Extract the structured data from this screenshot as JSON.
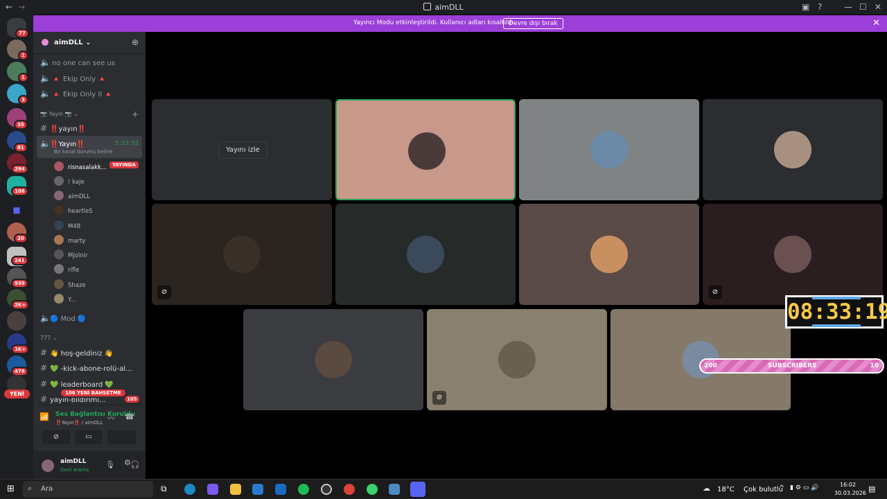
{
  "window": {
    "title": "aimDLL"
  },
  "banner": {
    "message": "Yayıncı Modu etkinleştirildi. Kullanıcı adları kısaltıldı.",
    "button": "Devre dışı bırak"
  },
  "guild_badges": [
    "77",
    "1",
    "1",
    "3",
    "35",
    "81",
    "294",
    "106",
    "20",
    "241",
    "939",
    "2K+",
    "1K+",
    "478"
  ],
  "guild_new": "YENİ",
  "server": {
    "name": "aimDLL"
  },
  "channels": {
    "c1": "no one can see us",
    "c2": "🔺 Ekip Only 🔺",
    "c3": "🔺 Ekip Only II 🔺",
    "cat_yayin": "Yayın",
    "c4": "‼️yayın‼️",
    "c5": "‼️Yayın‼️",
    "c5_timer": "5:13:53",
    "c5_status": "Bir kanal durumu belirle",
    "mod": "🔵 Mod 🔵",
    "cat_777": "777",
    "t1": "👋 hoş-geldiniz 👋",
    "t2": "💚 -kick-abone-rolü-al...",
    "t3": "💚 leaderboard 💚",
    "t4": "yayın-bildirimi...",
    "t4_count": "105",
    "mentions": "106 YENİ BAHSETME"
  },
  "voice_users": [
    "risnasalakk...",
    "! kaje",
    "aimDLL",
    "heartleS",
    "M48",
    "marty",
    "Mjolnir",
    "rifle",
    "Shaze",
    "Y..."
  ],
  "live_badge": "YAYINDA",
  "voice_status": {
    "title": "Ses Bağlantısı Kuruldu",
    "sub": "‼️Yayın‼️ / aimDLL"
  },
  "user": {
    "name": "aimDLL",
    "status": "Sesli arama"
  },
  "stage": {
    "watch_label": "Yayını izle"
  },
  "overlay": {
    "clock": "08:33:19",
    "subs_current": "200",
    "subs_label": "SUBSCRIBERS",
    "subs_goal": "10"
  },
  "taskbar": {
    "search": "Ara",
    "weather": "18°C",
    "weather_desc": "Çok bulutlu",
    "time": "16:02",
    "date": "30.03.2026"
  },
  "colors": {
    "banner": "#9b3fd8",
    "accent_green": "#23a559",
    "badge": "#da373c"
  }
}
